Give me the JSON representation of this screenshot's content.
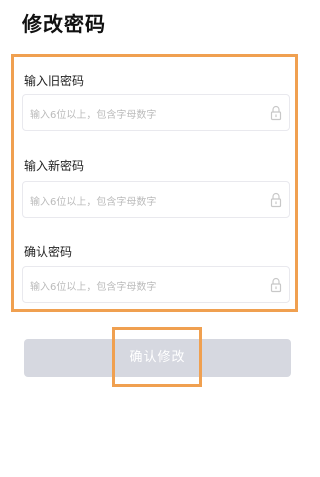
{
  "page": {
    "title": "修改密码"
  },
  "form": {
    "fields": [
      {
        "label": "输入旧密码",
        "placeholder": "输入6位以上，包含字母数字",
        "icon": "lock-icon"
      },
      {
        "label": "输入新密码",
        "placeholder": "输入6位以上，包含字母数字",
        "icon": "lock-icon"
      },
      {
        "label": "确认密码",
        "placeholder": "输入6位以上，包含字母数字",
        "icon": "lock-icon"
      }
    ],
    "submit_label": "确认修改"
  },
  "colors": {
    "highlight": "#f0a050",
    "button_bg": "#d6d8e0",
    "placeholder": "#bbbbbb"
  }
}
